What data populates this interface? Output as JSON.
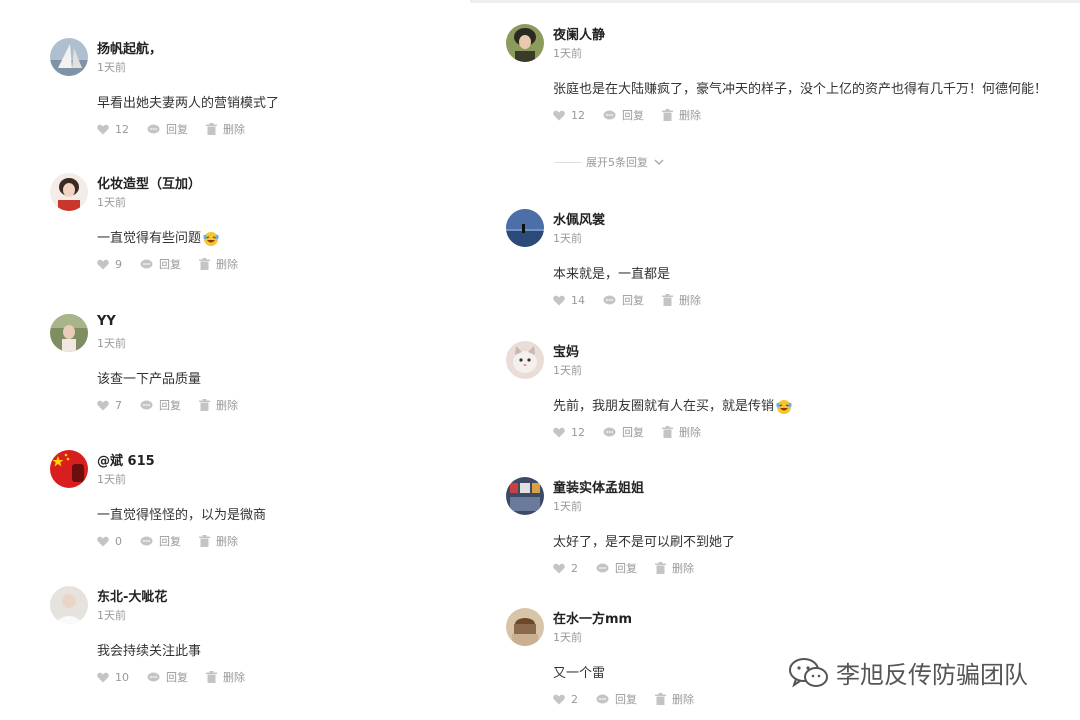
{
  "actions": {
    "reply_label": "回复",
    "delete_label": "删除"
  },
  "left_comments": [
    {
      "name": "扬帆起航，",
      "time": "1天前",
      "text": "早看出她夫妻两人的营销模式了",
      "likes": "12",
      "avatar_color": "#8aa0b8"
    },
    {
      "name": "化妆造型（互加）",
      "time": "1天前",
      "text": "一直觉得有些问题",
      "likes": "9",
      "avatar_color": "#c94a3a"
    },
    {
      "name": "YY",
      "time": "1天前",
      "text": "该查一下产品质量",
      "likes": "7",
      "avatar_color": "#8a9a6a"
    },
    {
      "name": "@斌 615",
      "time": "1天前",
      "text": "一直觉得怪怪的，以为是微商",
      "likes": "0",
      "avatar_color": "#d11f1f"
    },
    {
      "name": "东北-大呲花",
      "time": "1天前",
      "text": "我会持续关注此事",
      "likes": "10",
      "avatar_color": "#d8d2cc"
    }
  ],
  "right_comments": [
    {
      "name": "夜阑人静",
      "time": "1天前",
      "text": "张庭也是在大陆赚疯了，豪气冲天的样子，没个上亿的资产也得有几千万！何德何能！",
      "likes": "12",
      "avatar_color": "#6b7a4a"
    },
    {
      "name": "水佩风裳",
      "time": "1天前",
      "text": "本来就是，一直都是",
      "likes": "14",
      "avatar_color": "#4a6a9a"
    },
    {
      "name": "宝妈",
      "time": "1天前",
      "text": "先前，我朋友圈就有人在买，就是传销",
      "likes": "12",
      "avatar_color": "#c9a8a0"
    },
    {
      "name": "童装实体孟姐姐",
      "time": "1天前",
      "text": "太好了，是不是可以刷不到她了",
      "likes": "2",
      "avatar_color": "#5a6a8a"
    },
    {
      "name": "在水一方mm",
      "time": "1天前",
      "text": "又一个雷",
      "likes": "2",
      "avatar_color": "#8a6a4a"
    }
  ],
  "expand_replies": "展开5条回复",
  "watermark": "李旭反传防骗团队"
}
